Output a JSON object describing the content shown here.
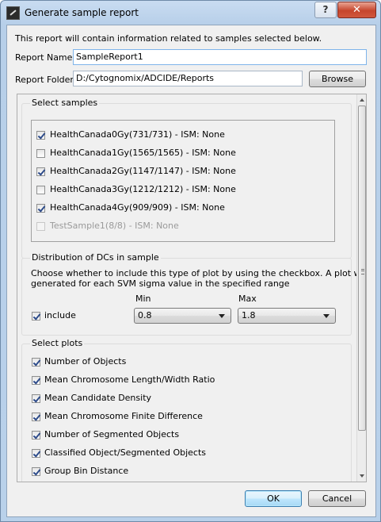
{
  "window": {
    "title": "Generate sample report",
    "help_label": "?",
    "close_label": "✕"
  },
  "intro_text": "This report will contain information related to samples selected below.",
  "report_name": {
    "label": "Report Name:",
    "value": "SampleReport1"
  },
  "report_folder": {
    "label": "Report Folder:",
    "value": "D:/Cytognomix/ADCIDE/Reports",
    "browse_label": "Browse"
  },
  "select_samples": {
    "title": "Select samples",
    "items": [
      {
        "label": "HealthCanada0Gy(731/731) - ISM: None",
        "checked": true,
        "enabled": true
      },
      {
        "label": "HealthCanada1Gy(1565/1565) - ISM: None",
        "checked": false,
        "enabled": true
      },
      {
        "label": "HealthCanada2Gy(1147/1147) - ISM: None",
        "checked": true,
        "enabled": true
      },
      {
        "label": "HealthCanada3Gy(1212/1212) - ISM: None",
        "checked": false,
        "enabled": true
      },
      {
        "label": "HealthCanada4Gy(909/909) - ISM: None",
        "checked": true,
        "enabled": true
      },
      {
        "label": "TestSample1(8/8) - ISM: None",
        "checked": false,
        "enabled": false
      }
    ]
  },
  "distribution": {
    "title": "Distribution of DCs in sample",
    "description_line1": "Choose whether to include this type of plot by using the checkbox. A plot will be",
    "description_line2": "generated for each SVM sigma value in the specified range",
    "include_label": "include",
    "include_checked": true,
    "min_label": "Min",
    "max_label": "Max",
    "min_value": "0.8",
    "max_value": "1.8"
  },
  "select_plots": {
    "title": "Select plots",
    "items": [
      {
        "label": "Number of Objects",
        "checked": true
      },
      {
        "label": "Mean Chromosome Length/Width Ratio",
        "checked": true
      },
      {
        "label": "Mean Candidate Density",
        "checked": true
      },
      {
        "label": "Mean Chromosome Finite Difference",
        "checked": true
      },
      {
        "label": "Number of Segmented Objects",
        "checked": true
      },
      {
        "label": "Classified Object/Segmented Objects",
        "checked": true
      },
      {
        "label": "Group Bin Distance",
        "checked": true
      }
    ]
  },
  "buttons": {
    "ok": "OK",
    "cancel": "Cancel"
  }
}
